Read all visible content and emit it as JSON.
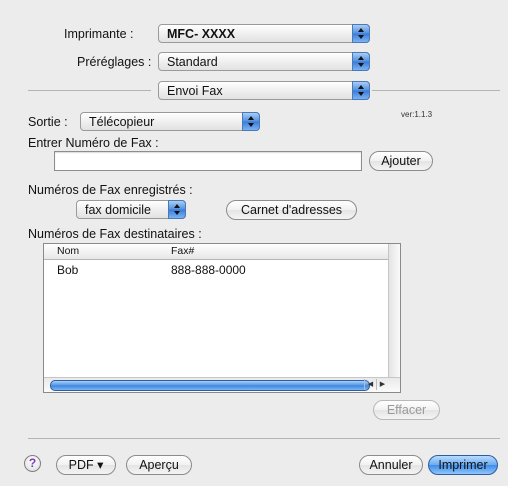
{
  "printer": {
    "label": "Imprimante :",
    "value": "MFC- XXXX"
  },
  "presets": {
    "label": "Préréglages :",
    "value": "Standard"
  },
  "section": {
    "value": "Envoi Fax"
  },
  "output": {
    "label": "Sortie :",
    "value": "Télécopieur",
    "version": "ver:1.1.3"
  },
  "fax_entry": {
    "label": "Entrer Numéro de Fax :",
    "value": "",
    "add_button": "Ajouter"
  },
  "saved": {
    "label": "Numéros de Fax enregistrés :",
    "value": "fax domicile",
    "addressbook_button": "Carnet d'adresses"
  },
  "recipients": {
    "label": "Numéros de Fax destinataires :",
    "columns": [
      "Nom",
      "Fax#"
    ],
    "rows": [
      {
        "name": "Bob",
        "fax": "888-888-0000"
      }
    ],
    "delete_button": "Effacer"
  },
  "footer": {
    "help_glyph": "?",
    "pdf_button": "PDF ▾",
    "preview_button": "Aperçu",
    "cancel_button": "Annuler",
    "print_button": "Imprimer"
  },
  "colors": {
    "accent": "#4f8fe0",
    "window_bg": "#ececec"
  }
}
